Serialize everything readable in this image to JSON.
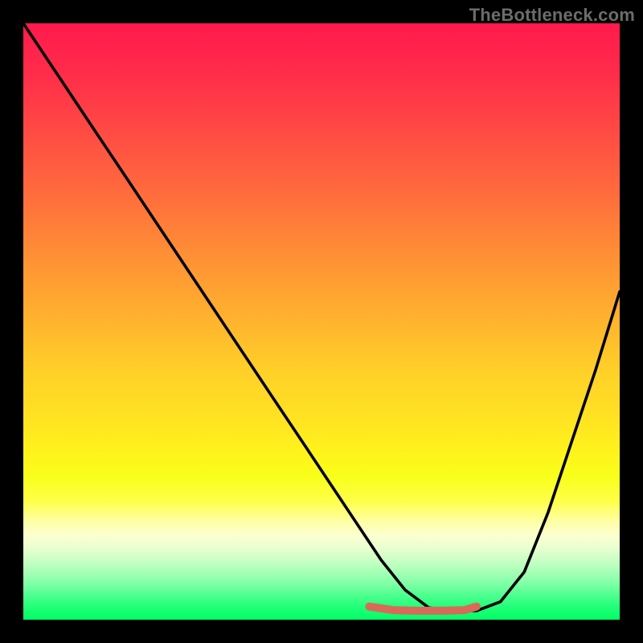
{
  "watermark": "TheBottleneck.com",
  "chart_data": {
    "type": "line",
    "title": "",
    "xlabel": "",
    "ylabel": "",
    "xlim": [
      0,
      100
    ],
    "ylim": [
      0,
      100
    ],
    "grid": false,
    "legend": false,
    "background": "rainbow-gradient (red top → yellow → green bottom)",
    "note": "V-shaped bottleneck curve with flat minimum; no axis ticks or numeric labels are rendered in the image",
    "series": [
      {
        "name": "bottleneck-curve",
        "color": "#000000",
        "x": [
          0,
          6,
          12,
          18,
          24,
          30,
          36,
          42,
          48,
          54,
          60,
          64,
          68,
          72,
          76,
          80,
          84,
          88,
          92,
          96,
          100
        ],
        "y": [
          100,
          91,
          82,
          73,
          64,
          55,
          46,
          37,
          28,
          19,
          10,
          5,
          2,
          1.5,
          1.5,
          3,
          8,
          18,
          30,
          42,
          55
        ]
      },
      {
        "name": "optimal-band-marker",
        "color": "#d96a5a",
        "x": [
          58,
          62,
          66,
          70,
          74,
          76
        ],
        "y": [
          2.2,
          1.6,
          1.5,
          1.5,
          1.6,
          2.2
        ]
      }
    ]
  }
}
